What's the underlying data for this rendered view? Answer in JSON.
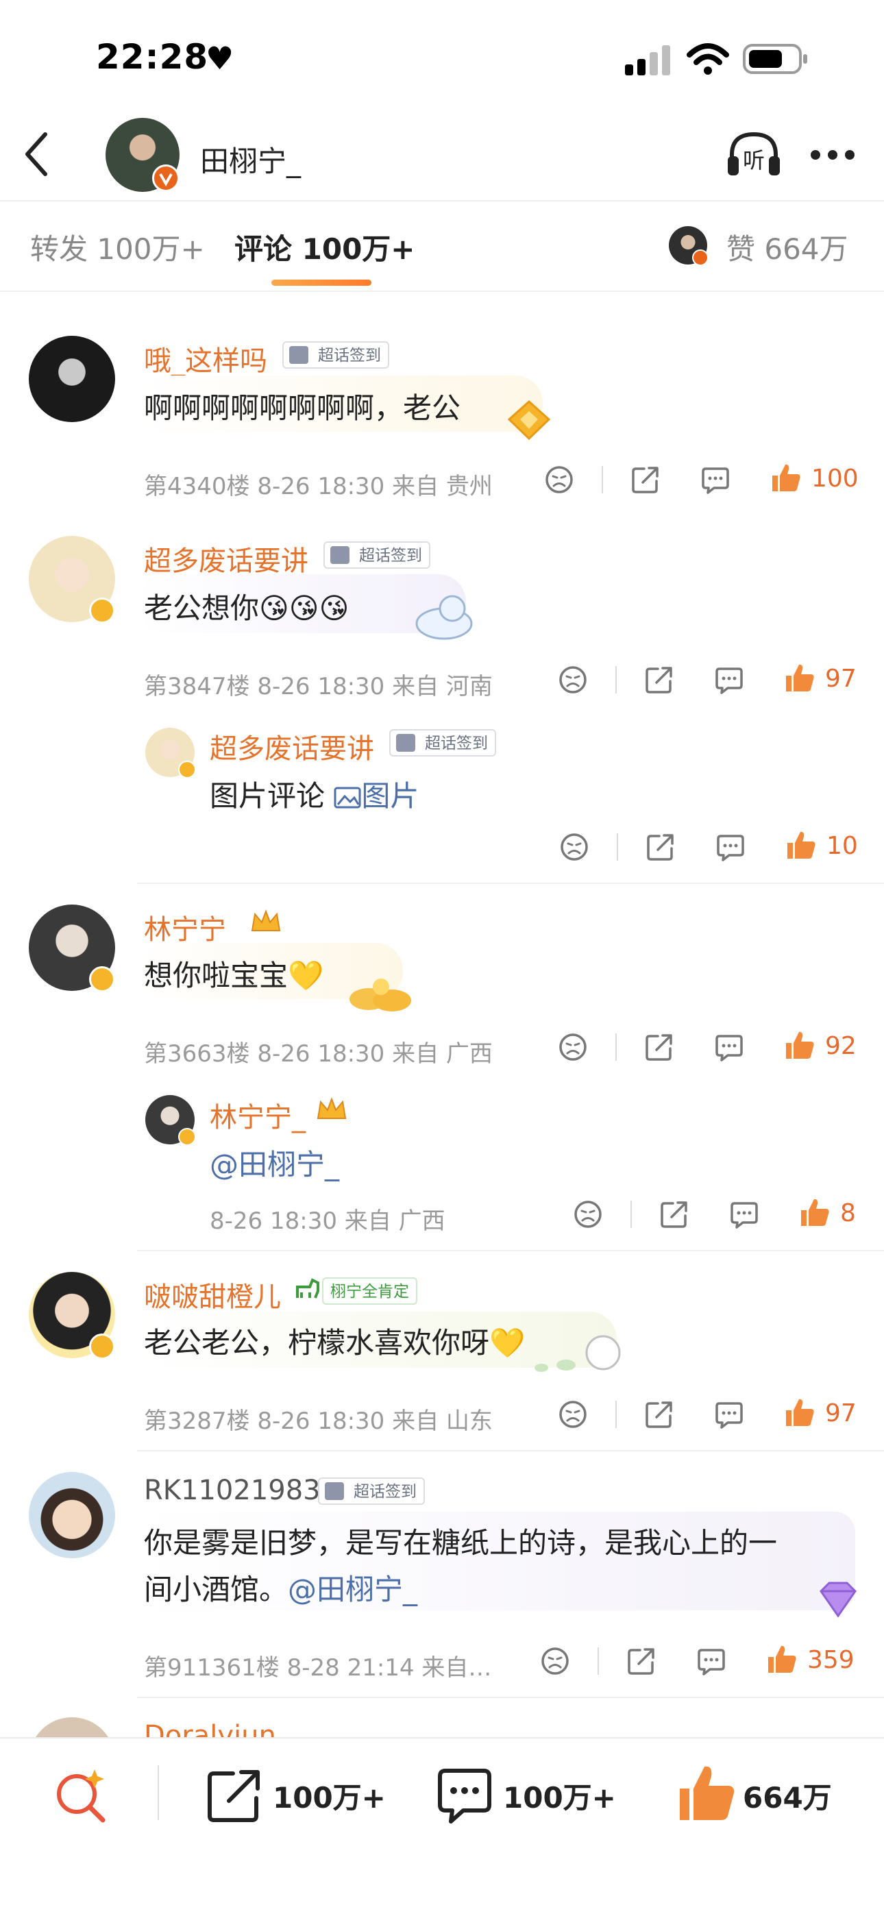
{
  "status": {
    "time": "22:28"
  },
  "header": {
    "title": "田栩宁_"
  },
  "tabs": {
    "repost": "转发 100万+",
    "comments": "评论 100万+",
    "likes": "赞 664万"
  },
  "comments": [
    {
      "user": "哦_这样吗",
      "tag": "超话签到",
      "text": "啊啊啊啊啊啊啊啊，老公",
      "floor": "第4340楼",
      "time": "8-26 18:30",
      "loc": "来自 贵州",
      "likes": "100"
    },
    {
      "user": "超多废话要讲",
      "tag": "超话签到",
      "text": "老公想你😘😘😘",
      "floor": "第3847楼",
      "time": "8-26 18:30",
      "loc": "来自 河南",
      "likes": "97",
      "reply": {
        "user": "超多废话要讲",
        "tag": "超话签到",
        "text": "图片评论",
        "link": "图片",
        "likes": "10"
      }
    },
    {
      "user": "林宁宁_",
      "text": "想你啦宝宝💛",
      "floor": "第3663楼",
      "time": "8-26 18:30",
      "loc": "来自 广西",
      "likes": "92",
      "reply": {
        "user": "林宁宁_",
        "mention": "@田栩宁_",
        "meta": "8-26 18:30  来自 广西",
        "likes": "8"
      }
    },
    {
      "user": "啵啵甜橙儿",
      "tag": "栩宁全肯定",
      "text": "老公老公，柠檬水喜欢你呀💛",
      "floor": "第3287楼",
      "time": "8-26 18:30",
      "loc": "来自 山东",
      "likes": "97"
    },
    {
      "user": "RK11021983",
      "tag": "超话签到",
      "text_line1": "你是雾是旧梦，是写在糖纸上的诗，是我心上的一",
      "text_line2": "间小酒馆。",
      "mention": "@田栩宁_",
      "meta": "第911361楼 8-28 21:14 来自…",
      "likes": "359"
    },
    {
      "user": "Doralyjun"
    }
  ],
  "bottom": {
    "reposts": "100万+",
    "comments": "100万+",
    "likes": "664万"
  },
  "colors": {
    "accent": "#e5732b",
    "link": "#4d6fa9",
    "gold": "#f5b42a"
  }
}
